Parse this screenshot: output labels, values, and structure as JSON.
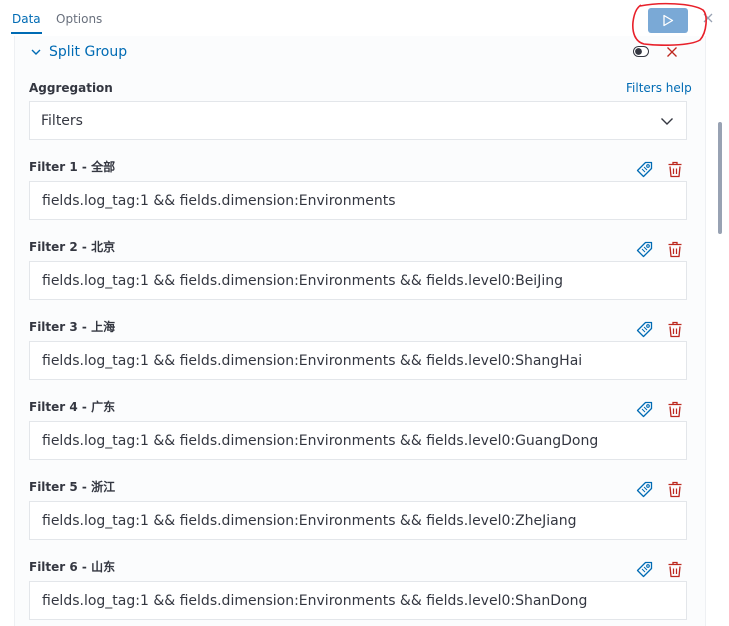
{
  "tabs": [
    {
      "label": "Data",
      "active": true
    },
    {
      "label": "Options",
      "active": false
    }
  ],
  "toolbar": {
    "run_icon": "play-icon",
    "close_icon": "close-icon",
    "run_button_color": "#7aa9d6",
    "annotation_color": "#e8202a"
  },
  "group": {
    "title": "Split Group",
    "toggle_icon": "toggle-icon",
    "remove_icon": "close-icon"
  },
  "aggregation": {
    "label": "Aggregation",
    "help_link": "Filters help",
    "selected": "Filters"
  },
  "filters": [
    {
      "label": "Filter 1 - 全部",
      "value": "fields.log_tag:1 && fields.dimension:Environments"
    },
    {
      "label": "Filter 2 - 北京",
      "value": "fields.log_tag:1 && fields.dimension:Environments && fields.level0:BeiJing"
    },
    {
      "label": "Filter 3 - 上海",
      "value": "fields.log_tag:1 && fields.dimension:Environments && fields.level0:ShangHai"
    },
    {
      "label": "Filter 4 - 广东",
      "value": "fields.log_tag:1 && fields.dimension:Environments && fields.level0:GuangDong"
    },
    {
      "label": "Filter 5 - 浙江",
      "value": "fields.log_tag:1 && fields.dimension:Environments && fields.level0:ZheJiang"
    },
    {
      "label": "Filter 6 - 山东",
      "value": "fields.log_tag:1 && fields.dimension:Environments && fields.level0:ShanDong"
    }
  ],
  "colors": {
    "accent": "#006bb4",
    "danger": "#bd271e",
    "text": "#343741"
  }
}
